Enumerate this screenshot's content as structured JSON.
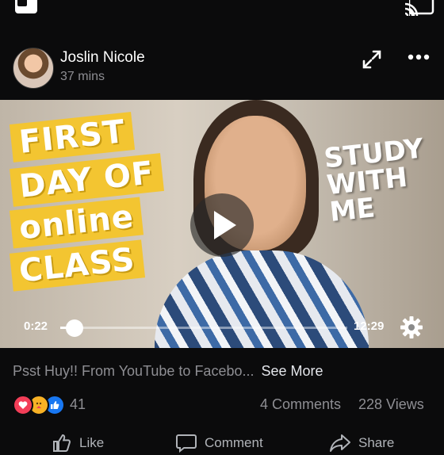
{
  "post": {
    "author": "Joslin Nicole",
    "time": "37 mins"
  },
  "video": {
    "overlay_title_lines": [
      "FIRST",
      "DAY OF",
      "online",
      "CLASS"
    ],
    "overlay_side_lines": [
      "STUDY",
      "WITH",
      "ME"
    ],
    "current_time": "0:22",
    "duration": "12:29",
    "progress_fraction": 0.05
  },
  "caption": {
    "text": "Psst Huy!! From YouTube to Facebo...",
    "see_more": "See More"
  },
  "stats": {
    "reaction_count": "41",
    "comments": "4 Comments",
    "views": "228 Views"
  },
  "actions": {
    "like": "Like",
    "comment": "Comment",
    "share": "Share"
  },
  "colors": {
    "background": "#0b0b0c",
    "muted_text": "#8e8e93",
    "accent_blue": "#1877f2",
    "love_red": "#f33e58",
    "overlay_yellow": "#f3c531"
  }
}
